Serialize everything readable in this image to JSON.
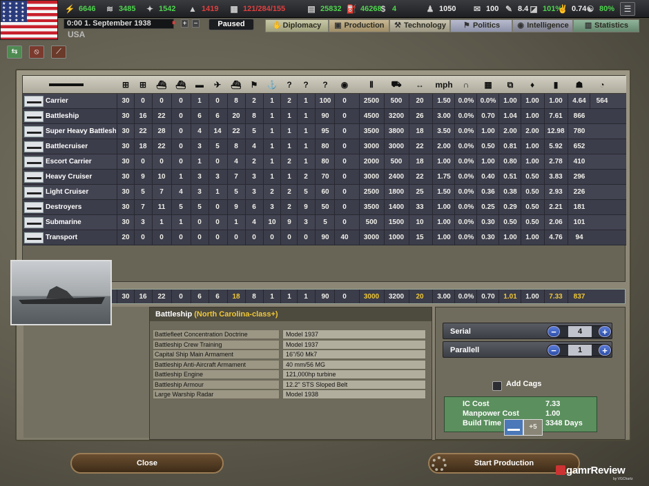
{
  "topbar": {
    "resources": [
      {
        "icon": "energy-icon",
        "value": "6646",
        "color": "g"
      },
      {
        "icon": "metal-icon",
        "value": "3485",
        "color": "g"
      },
      {
        "icon": "rare-materials-icon",
        "value": "1542",
        "color": "g"
      },
      {
        "icon": "oil-icon",
        "value": "1419",
        "color": "r"
      },
      {
        "icon": "ic-icon",
        "value": "121/284/155",
        "color": "r"
      },
      {
        "icon": "supplies-icon",
        "value": "25832",
        "color": "g"
      },
      {
        "icon": "fuel-icon",
        "value": "46268",
        "color": "g"
      },
      {
        "icon": "money-icon",
        "value": "4",
        "color": "g"
      },
      {
        "icon": "manpower-icon",
        "value": "1050",
        "color": "w"
      },
      {
        "icon": "diplomacy-icon",
        "value": "100",
        "color": "w"
      },
      {
        "icon": "leadership-icon",
        "value": "8.4",
        "color": "w"
      },
      {
        "icon": "dissent-icon",
        "value": "101%",
        "color": "g"
      },
      {
        "icon": "national-unity-icon",
        "value": "0.74",
        "color": "w"
      },
      {
        "icon": "war-support-icon",
        "value": "80%",
        "color": "g"
      }
    ],
    "date": "0:00 1. September 1938",
    "country": "USA",
    "pause_label": "Paused",
    "flag_stars": "★ ★ ★ ★ ★ ★ ★ ★ ★ ★ ★ ★ ★ ★ ★ ★ ★ ★ ★ ★ ★ ★ ★ ★ ★ ★ ★ ★ ★ ★ ★ ★ ★ ★ ★ ★"
  },
  "tabs": [
    "Diplomacy",
    "Production",
    "Technology",
    "Politics",
    "Intelligence",
    "Statistics"
  ],
  "columns": [
    "30",
    "",
    "",
    "",
    "",
    "",
    "",
    "",
    "",
    "",
    "",
    "",
    "",
    "",
    "",
    "",
    "",
    "",
    "",
    "",
    "",
    "",
    "",
    "",
    "",
    ""
  ],
  "table": {
    "rows": [
      {
        "name": "Carrier",
        "vals": [
          "30",
          "0",
          "0",
          "0",
          "1",
          "0",
          "8",
          "2",
          "1",
          "2",
          "1",
          "100",
          "0",
          "2500",
          "500",
          "20",
          "1.50",
          "0.0%",
          "0.0%",
          "1.00",
          "1.00",
          "1.00",
          "4.64",
          "564"
        ]
      },
      {
        "name": "Battleship",
        "vals": [
          "30",
          "16",
          "22",
          "0",
          "6",
          "6",
          "20",
          "8",
          "1",
          "1",
          "1",
          "90",
          "0",
          "4500",
          "3200",
          "26",
          "3.00",
          "0.0%",
          "0.70",
          "1.04",
          "1.00",
          "7.61",
          "866"
        ]
      },
      {
        "name": "Super Heavy Battleship",
        "vals": [
          "30",
          "22",
          "28",
          "0",
          "4",
          "14",
          "22",
          "5",
          "1",
          "1",
          "1",
          "95",
          "0",
          "3500",
          "3800",
          "18",
          "3.50",
          "0.0%",
          "1.00",
          "2.00",
          "2.00",
          "12.98",
          "780"
        ]
      },
      {
        "name": "Battlecruiser",
        "vals": [
          "30",
          "18",
          "22",
          "0",
          "3",
          "5",
          "8",
          "4",
          "1",
          "1",
          "1",
          "80",
          "0",
          "3000",
          "3000",
          "22",
          "2.00",
          "0.0%",
          "0.50",
          "0.81",
          "1.00",
          "5.92",
          "652"
        ]
      },
      {
        "name": "Escort Carrier",
        "vals": [
          "30",
          "0",
          "0",
          "0",
          "1",
          "0",
          "4",
          "2",
          "1",
          "2",
          "1",
          "80",
          "0",
          "2000",
          "500",
          "18",
          "1.00",
          "0.0%",
          "1.00",
          "0.80",
          "1.00",
          "2.78",
          "410"
        ]
      },
      {
        "name": "Heavy Cruiser",
        "vals": [
          "30",
          "9",
          "10",
          "1",
          "3",
          "3",
          "7",
          "3",
          "1",
          "1",
          "2",
          "70",
          "0",
          "3000",
          "2400",
          "22",
          "1.75",
          "0.0%",
          "0.40",
          "0.51",
          "0.50",
          "3.83",
          "296"
        ]
      },
      {
        "name": "Light Cruiser",
        "vals": [
          "30",
          "5",
          "7",
          "4",
          "3",
          "1",
          "5",
          "3",
          "2",
          "2",
          "5",
          "60",
          "0",
          "2500",
          "1800",
          "25",
          "1.50",
          "0.0%",
          "0.36",
          "0.38",
          "0.50",
          "2.93",
          "226"
        ]
      },
      {
        "name": "Destroyers",
        "vals": [
          "30",
          "7",
          "11",
          "5",
          "5",
          "0",
          "9",
          "6",
          "3",
          "2",
          "9",
          "50",
          "0",
          "3500",
          "1400",
          "33",
          "1.00",
          "0.0%",
          "0.25",
          "0.29",
          "0.50",
          "2.21",
          "181"
        ]
      },
      {
        "name": "Submarine",
        "vals": [
          "30",
          "3",
          "1",
          "1",
          "0",
          "0",
          "1",
          "4",
          "10",
          "9",
          "3",
          "5",
          "0",
          "500",
          "1500",
          "10",
          "1.00",
          "0.0%",
          "0.30",
          "0.50",
          "0.50",
          "2.06",
          "101"
        ]
      },
      {
        "name": "Transport",
        "vals": [
          "20",
          "0",
          "0",
          "0",
          "0",
          "0",
          "0",
          "0",
          "0",
          "0",
          "0",
          "90",
          "40",
          "3000",
          "1000",
          "15",
          "1.00",
          "0.0%",
          "0.30",
          "1.00",
          "1.00",
          "4.76",
          "94"
        ]
      }
    ],
    "selected": {
      "name": "Battleship",
      "vals": [
        "30",
        "16",
        "22",
        "0",
        "6",
        "6",
        "18",
        "8",
        "1",
        "1",
        "1",
        "90",
        "0",
        "3000",
        "3200",
        "20",
        "3.00",
        "0.0%",
        "0.70",
        "1.01",
        "1.00",
        "7.33",
        "837"
      ],
      "highlight": [
        6,
        13,
        15,
        19,
        21,
        22
      ]
    }
  },
  "detail": {
    "title": "Battleship",
    "subtitle": "(North Carolina-class+)",
    "components": [
      {
        "name": "Battlefleet Concentration Doctrine",
        "value": "Model 1937"
      },
      {
        "name": "Battleship Crew Training",
        "value": "Model 1937"
      },
      {
        "name": "Capital Ship Main Armament",
        "value": "16\"/50 Mk7"
      },
      {
        "name": "Battleship Anti-Aircraft Armament",
        "value": "40 mm/56 MG"
      },
      {
        "name": "Battleship Engine",
        "value": "121,000hp turbine"
      },
      {
        "name": "Battleship Armour",
        "value": "12.2\" STS Sloped Belt"
      },
      {
        "name": "Large Warship Radar",
        "value": "Model 1938"
      }
    ]
  },
  "production": {
    "serial_label": "Serial",
    "serial_value": "4",
    "parallel_label": "Parallell",
    "parallel_value": "1",
    "add_cags": "Add Cags",
    "costs": [
      {
        "k": "IC Cost",
        "v": "7.33"
      },
      {
        "k": "Manpower Cost",
        "v": "1.00"
      },
      {
        "k": "Build Time",
        "v": "3348 Days"
      }
    ],
    "queue_plus": "+5"
  },
  "buttons": {
    "close": "Close",
    "start": "Start Production"
  },
  "watermark": {
    "brand": "gamrReview",
    "sub": "by VGChartz"
  }
}
